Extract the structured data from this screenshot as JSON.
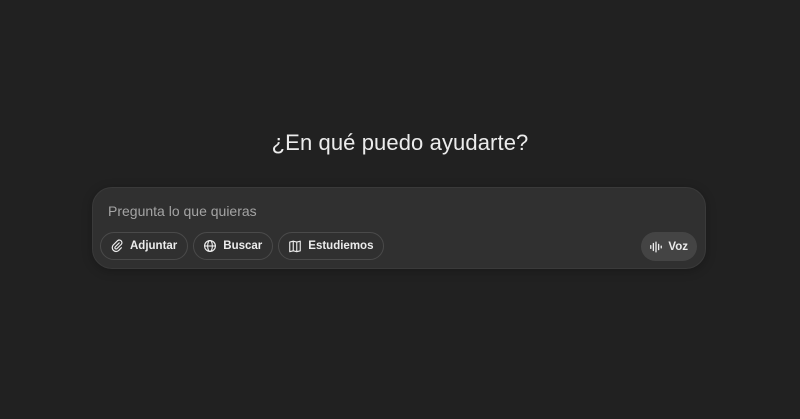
{
  "main": {
    "heading": "¿En qué puedo ayudarte?"
  },
  "composer": {
    "placeholder": "Pregunta lo que quieras",
    "value": "",
    "tools": [
      {
        "label": "Adjuntar",
        "icon": "paperclip-icon"
      },
      {
        "label": "Buscar",
        "icon": "globe-icon"
      },
      {
        "label": "Estudiemos",
        "icon": "book-icon"
      }
    ],
    "voice": {
      "label": "Voz",
      "icon": "voice-waveform-icon"
    }
  },
  "colors": {
    "background": "#212121",
    "composer_background": "#303030",
    "pill_border": "#4a4a4a",
    "voice_button_background": "#444444",
    "text": "#ececec",
    "placeholder": "#a4a4a4"
  }
}
